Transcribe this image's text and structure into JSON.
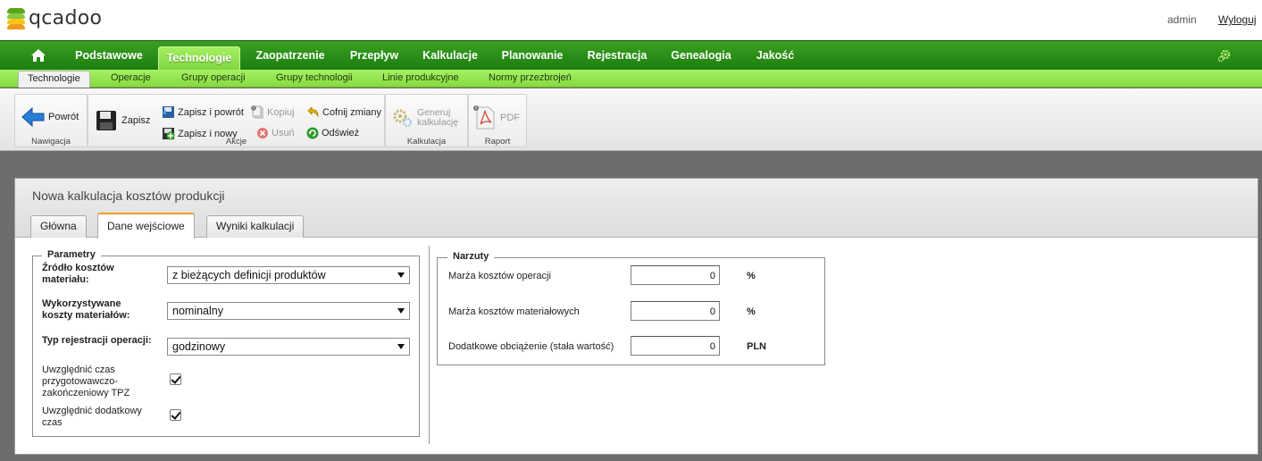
{
  "header": {
    "app_name": "qcadoo",
    "user": "admin",
    "logout": "Wyloguj",
    "colors": {
      "logo_green": "#5aa51e",
      "logo_orange": "#f09a1c",
      "logo_yellow": "#f4c718"
    }
  },
  "main_menu": {
    "home_icon": "home-icon",
    "items": [
      "Podstawowe",
      "Technologie",
      "Zaopatrzenie",
      "Przepływ",
      "Kalkulacje",
      "Planowanie",
      "Rejestracja",
      "Genealogia",
      "Jakość"
    ],
    "active": "Technologie",
    "settings_icon": "gear-icon"
  },
  "sub_menu": {
    "items": [
      "Technologie",
      "Operacje",
      "Grupy operacji",
      "Grupy technologii",
      "Linie produkcyjne",
      "Normy przezbrojeń"
    ],
    "active": "Technologie"
  },
  "ribbon": {
    "navigation": {
      "label": "Nawigacja",
      "back": "Powrót"
    },
    "actions": {
      "label": "Akcje",
      "save": "Zapisz",
      "save_back": "Zapisz i powrót",
      "save_new": "Zapisz i nowy",
      "copy": "Kopiuj",
      "delete": "Usuń",
      "undo": "Cofnij zmiany",
      "refresh": "Odśwież"
    },
    "calculation": {
      "label": "Kalkulacja",
      "generate_line1": "Generuj",
      "generate_line2": "kalkulację"
    },
    "report": {
      "label": "Raport",
      "pdf": "PDF"
    }
  },
  "window": {
    "title": "Nowa kalkulacja kosztów produkcji",
    "tabs": [
      "Główna",
      "Dane wejściowe",
      "Wyniki kalkulacji"
    ],
    "active_tab": "Dane wejściowe"
  },
  "parameters": {
    "legend": "Parametry",
    "material_cost_source": {
      "label_line1": "Źródło kosztów",
      "label_line2": "materiału:",
      "value": "z bieżących definicji produktów"
    },
    "material_costs_used": {
      "label_line1": "Wykorzystywane",
      "label_line2": "koszty materiałów:",
      "value": "nominalny"
    },
    "operation_registration_type": {
      "label": "Typ rejestracji operacji:",
      "value": "godzinowy"
    },
    "include_tpz": {
      "label_line1": "Uwzględnić czas",
      "label_line2": "przygotowawczo-",
      "label_line3": "zakończeniowy TPZ",
      "checked": true
    },
    "include_additional_time": {
      "label_line1": "Uwzględnić dodatkowy",
      "label_line2": "czas",
      "checked": true
    }
  },
  "markups": {
    "legend": "Narzuty",
    "operation_cost_margin": {
      "label": "Marża kosztów operacji",
      "value": "0",
      "unit": "%"
    },
    "material_cost_margin": {
      "label": "Marża kosztów materiałowych",
      "value": "0",
      "unit": "%"
    },
    "additional_overhead": {
      "label": "Dodatkowe obciążenie (stała wartość)",
      "value": "0",
      "unit": "PLN"
    }
  }
}
